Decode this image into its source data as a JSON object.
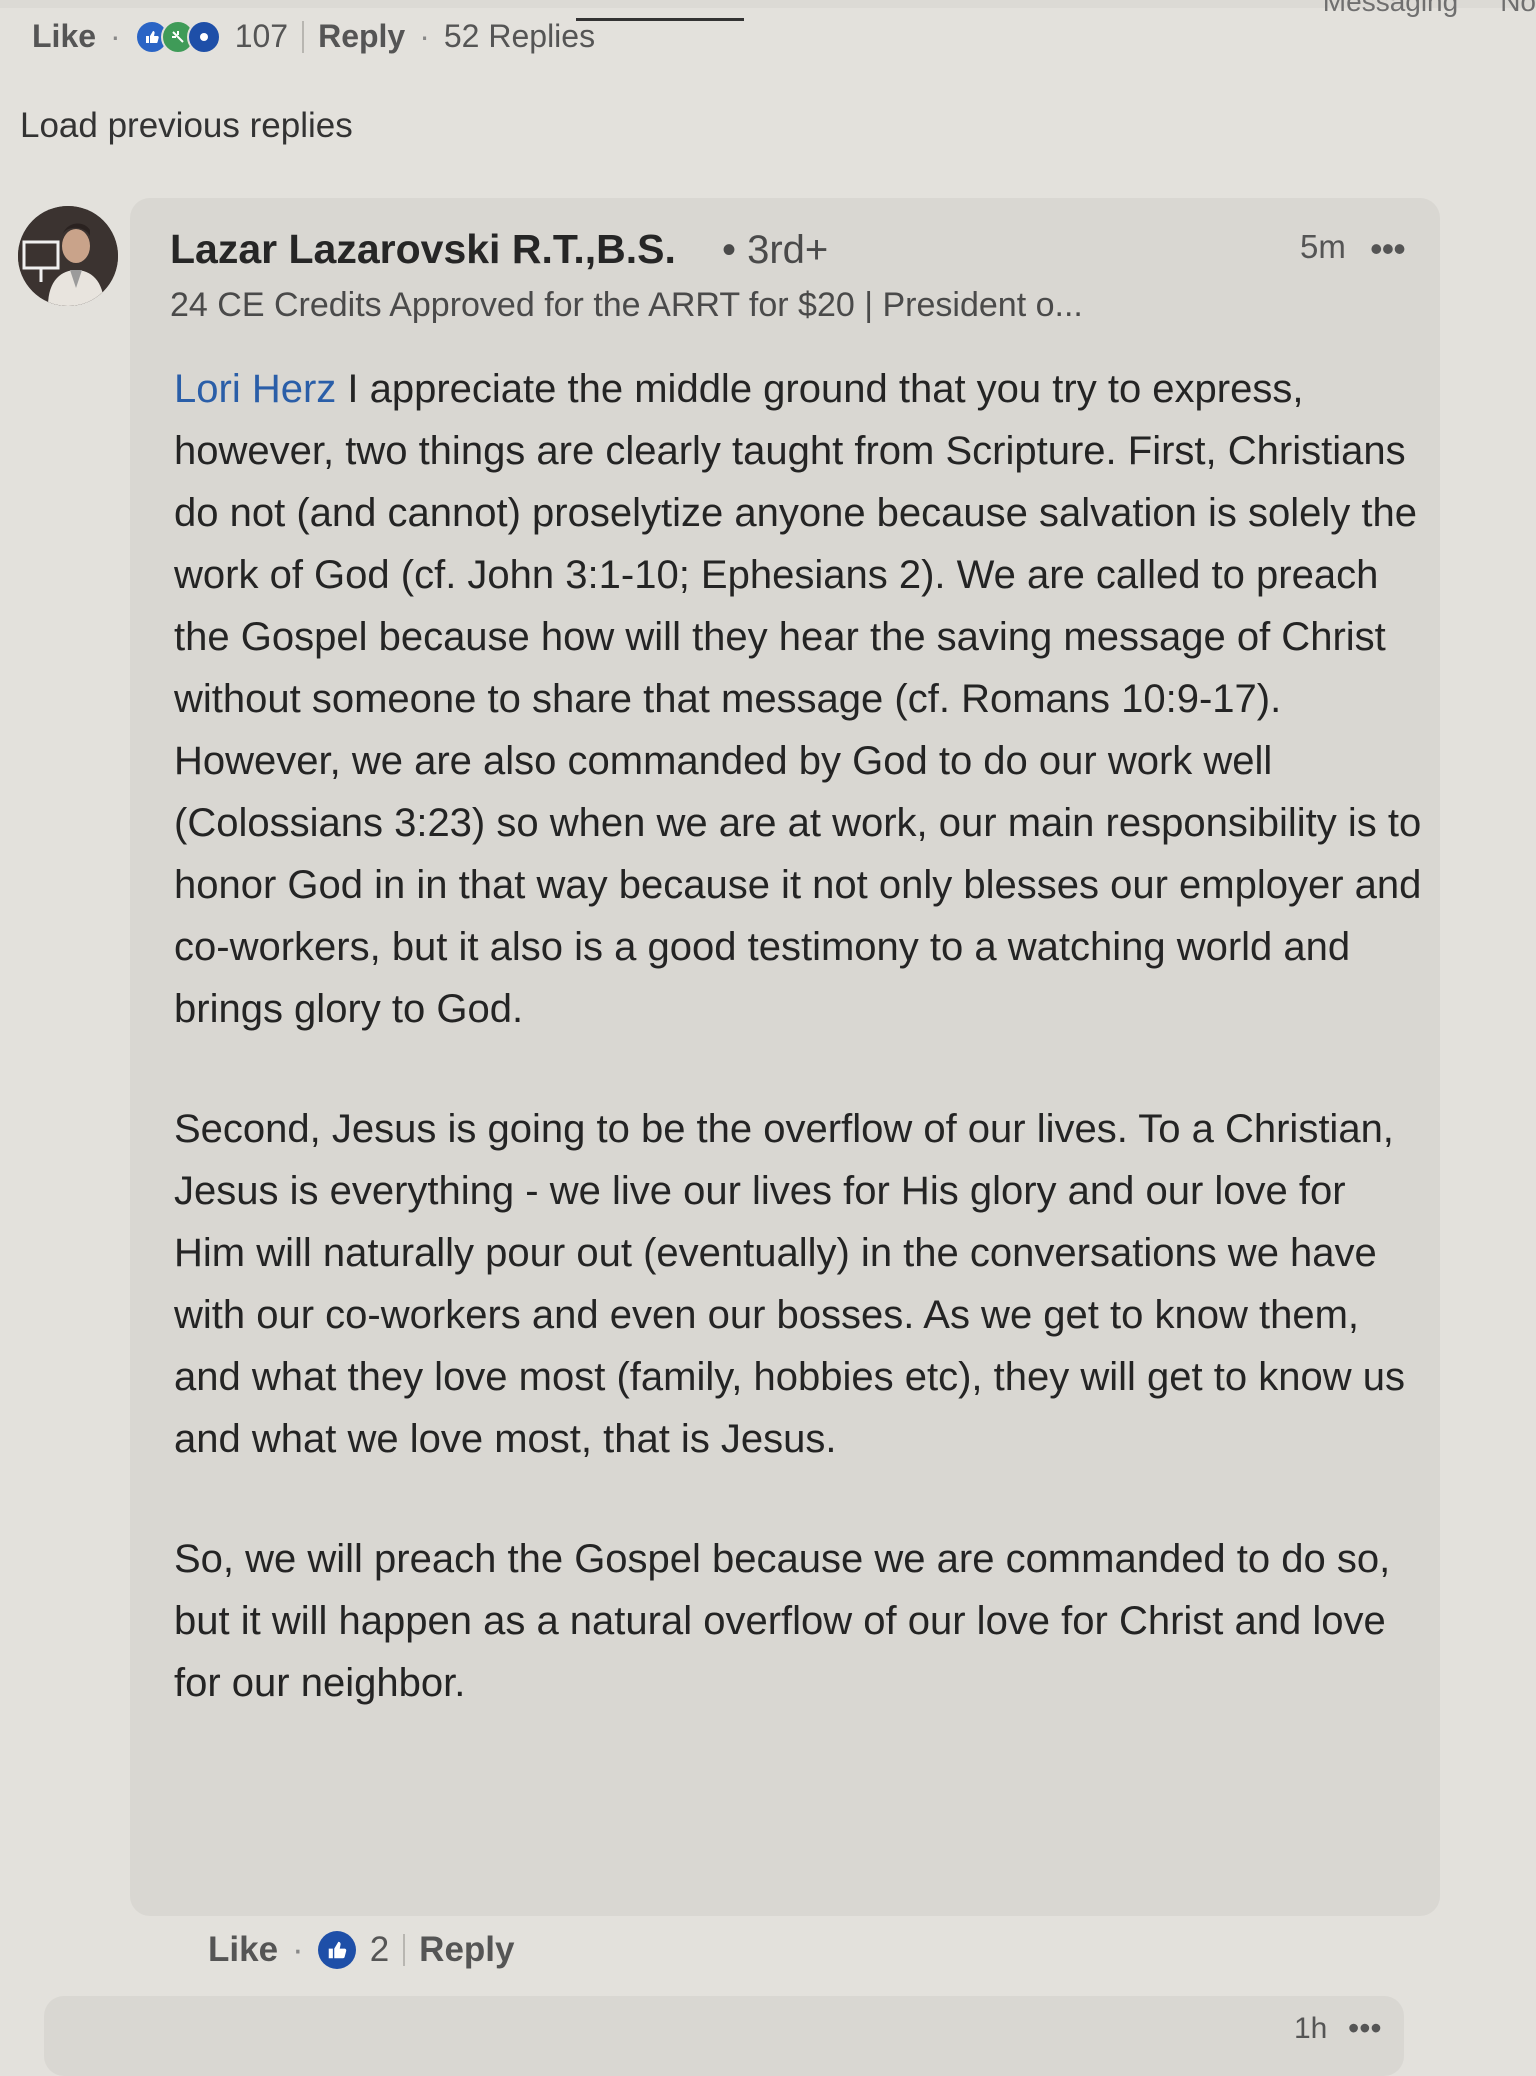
{
  "top_nav": {
    "messaging_label": "Messaging",
    "notifications_label_partial": "No"
  },
  "parent_comment_actions": {
    "like_label": "Like",
    "reaction_count": "107",
    "reply_label": "Reply",
    "replies_count_label": "52 Replies"
  },
  "load_previous_replies": "Load previous replies",
  "comment": {
    "author_name": "Lazar Lazarovski R.T.,B.S.",
    "connection_degree": "• 3rd+",
    "headline": "24 CE Credits Approved for the ARRT for $20 | President o...",
    "timestamp": "5m",
    "more_label": "•••",
    "mention": "Lori Herz",
    "paragraph_1_rest": " I appreciate the middle ground that you try to express, however, two things are clearly taught from Scripture. First, Christians do not (and cannot) proselytize anyone because salvation is solely the work of God (cf. John 3:1-10; Ephesians 2). We are called to preach the Gospel because how will they hear the saving message of Christ without someone to share that message (cf. Romans 10:9-17). However, we are also commanded by God to do our work well (Colossians 3:23) so when we are at work, our main responsibility is to honor God in in that way because it not only blesses our employer and co-workers, but it also is a good testimony to a watching world and brings glory to God.",
    "paragraph_2": "Second, Jesus is going to be the overflow of our lives. To a Christian, Jesus is everything - we live our lives for His glory and our love for Him will naturally pour out (eventually) in the conversations we have with our co-workers and even our bosses. As we get to know them, and what they love most (family, hobbies etc), they will get to know us and what we love most, that is Jesus.",
    "paragraph_3": "So, we will preach the Gospel because we are commanded to do so, but it will happen as a natural overflow of our love for Christ and love for our neighbor.",
    "actions": {
      "like_label": "Like",
      "reaction_count": "2",
      "reply_label": "Reply"
    }
  },
  "next_comment": {
    "timestamp": "1h",
    "more_label": "•••"
  },
  "colors": {
    "mention": "#2a5ea8",
    "like_badge": "#1e4fa8",
    "card_background": "#d9d7d2",
    "page_background": "#e3e1dc"
  }
}
